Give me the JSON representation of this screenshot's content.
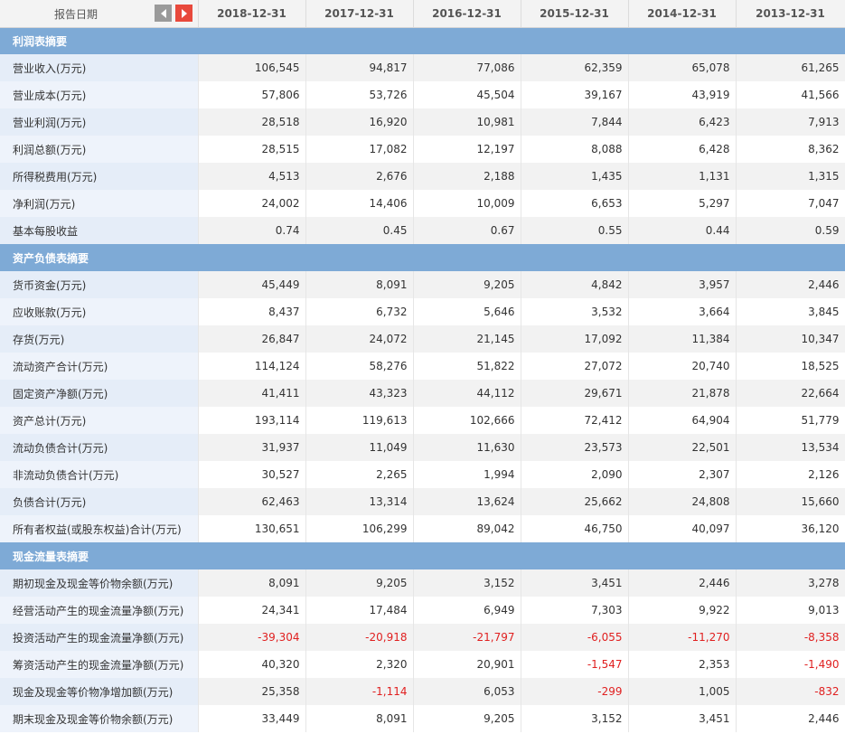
{
  "header": {
    "date_label": "报告日期",
    "prev_icon": "chevron-left-icon",
    "next_icon": "chevron-right-icon",
    "years": [
      "2018-12-31",
      "2017-12-31",
      "2016-12-31",
      "2015-12-31",
      "2014-12-31",
      "2013-12-31"
    ]
  },
  "colors": {
    "section_bg": "#7eaad6",
    "negative": "#e02020",
    "next_button": "#e8493c",
    "prev_button": "#9a9a9a"
  },
  "sections": [
    {
      "title": "利润表摘要",
      "rows": [
        {
          "label": "营业收入(万元)",
          "values": [
            "106,545",
            "94,817",
            "77,086",
            "62,359",
            "65,078",
            "61,265"
          ]
        },
        {
          "label": "营业成本(万元)",
          "values": [
            "57,806",
            "53,726",
            "45,504",
            "39,167",
            "43,919",
            "41,566"
          ]
        },
        {
          "label": "营业利润(万元)",
          "values": [
            "28,518",
            "16,920",
            "10,981",
            "7,844",
            "6,423",
            "7,913"
          ]
        },
        {
          "label": "利润总额(万元)",
          "values": [
            "28,515",
            "17,082",
            "12,197",
            "8,088",
            "6,428",
            "8,362"
          ]
        },
        {
          "label": "所得税费用(万元)",
          "values": [
            "4,513",
            "2,676",
            "2,188",
            "1,435",
            "1,131",
            "1,315"
          ]
        },
        {
          "label": "净利润(万元)",
          "values": [
            "24,002",
            "14,406",
            "10,009",
            "6,653",
            "5,297",
            "7,047"
          ]
        },
        {
          "label": "基本每股收益",
          "values": [
            "0.74",
            "0.45",
            "0.67",
            "0.55",
            "0.44",
            "0.59"
          ]
        }
      ]
    },
    {
      "title": "资产负债表摘要",
      "rows": [
        {
          "label": "货币资金(万元)",
          "values": [
            "45,449",
            "8,091",
            "9,205",
            "4,842",
            "3,957",
            "2,446"
          ]
        },
        {
          "label": "应收账款(万元)",
          "values": [
            "8,437",
            "6,732",
            "5,646",
            "3,532",
            "3,664",
            "3,845"
          ]
        },
        {
          "label": "存货(万元)",
          "values": [
            "26,847",
            "24,072",
            "21,145",
            "17,092",
            "11,384",
            "10,347"
          ]
        },
        {
          "label": "流动资产合计(万元)",
          "values": [
            "114,124",
            "58,276",
            "51,822",
            "27,072",
            "20,740",
            "18,525"
          ]
        },
        {
          "label": "固定资产净额(万元)",
          "values": [
            "41,411",
            "43,323",
            "44,112",
            "29,671",
            "21,878",
            "22,664"
          ]
        },
        {
          "label": "资产总计(万元)",
          "values": [
            "193,114",
            "119,613",
            "102,666",
            "72,412",
            "64,904",
            "51,779"
          ]
        },
        {
          "label": "流动负债合计(万元)",
          "values": [
            "31,937",
            "11,049",
            "11,630",
            "23,573",
            "22,501",
            "13,534"
          ]
        },
        {
          "label": "非流动负债合计(万元)",
          "values": [
            "30,527",
            "2,265",
            "1,994",
            "2,090",
            "2,307",
            "2,126"
          ]
        },
        {
          "label": "负债合计(万元)",
          "values": [
            "62,463",
            "13,314",
            "13,624",
            "25,662",
            "24,808",
            "15,660"
          ]
        },
        {
          "label": "所有者权益(或股东权益)合计(万元)",
          "values": [
            "130,651",
            "106,299",
            "89,042",
            "46,750",
            "40,097",
            "36,120"
          ]
        }
      ]
    },
    {
      "title": "现金流量表摘要",
      "rows": [
        {
          "label": "期初现金及现金等价物余额(万元)",
          "values": [
            "8,091",
            "9,205",
            "3,152",
            "3,451",
            "2,446",
            "3,278"
          ]
        },
        {
          "label": "经营活动产生的现金流量净额(万元)",
          "values": [
            "24,341",
            "17,484",
            "6,949",
            "7,303",
            "9,922",
            "9,013"
          ]
        },
        {
          "label": "投资活动产生的现金流量净额(万元)",
          "values": [
            "-39,304",
            "-20,918",
            "-21,797",
            "-6,055",
            "-11,270",
            "-8,358"
          ]
        },
        {
          "label": "筹资活动产生的现金流量净额(万元)",
          "values": [
            "40,320",
            "2,320",
            "20,901",
            "-1,547",
            "2,353",
            "-1,490"
          ]
        },
        {
          "label": "现金及现金等价物净增加额(万元)",
          "values": [
            "25,358",
            "-1,114",
            "6,053",
            "-299",
            "1,005",
            "-832"
          ]
        },
        {
          "label": "期末现金及现金等价物余额(万元)",
          "values": [
            "33,449",
            "8,091",
            "9,205",
            "3,152",
            "3,451",
            "2,446"
          ]
        }
      ]
    }
  ]
}
